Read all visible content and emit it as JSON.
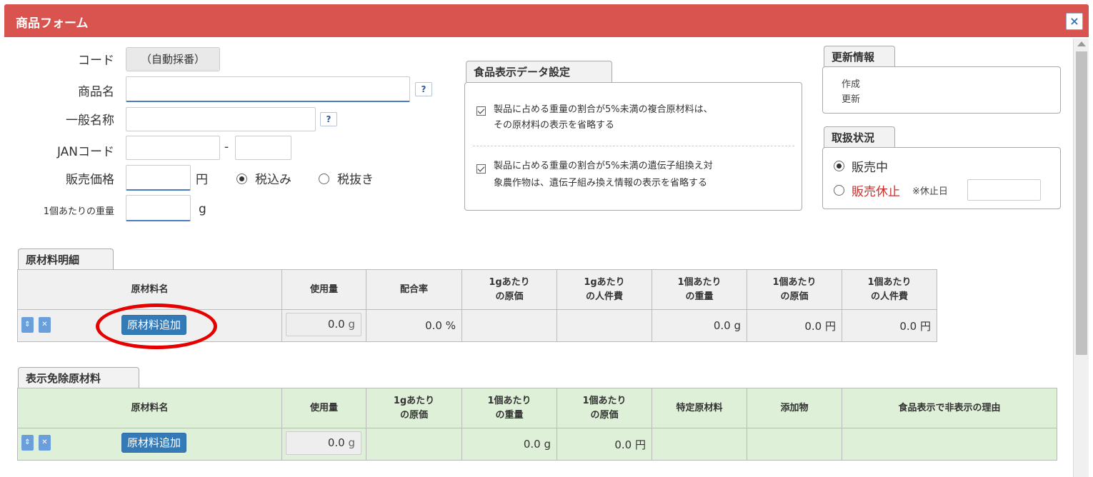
{
  "dialog": {
    "title": "商品フォーム",
    "close": "×"
  },
  "form": {
    "code_label": "コード",
    "code_value": "（自動採番）",
    "name_label": "商品名",
    "general_name_label": "一般名称",
    "help": "?",
    "jan_label": "JANコード",
    "jan_sep": "-",
    "price_label": "販売価格",
    "price_unit": "円",
    "tax_incl": "税込み",
    "tax_excl": "税抜き",
    "weight_label": "1個あたりの重量",
    "weight_unit": "g"
  },
  "food_display": {
    "legend": "食品表示データ設定",
    "option1_line1": "製品に占める重量の割合が5%未満の複合原材料は、",
    "option1_line2": "その原材料の表示を省略する",
    "option2_line1": "製品に占める重量の割合が5%未満の遺伝子組換え対",
    "option2_line2": "象農作物は、遺伝子組み換え情報の表示を省略する"
  },
  "update_info": {
    "legend": "更新情報",
    "created": "作成",
    "updated": "更新"
  },
  "handling": {
    "legend": "取扱状況",
    "on_sale": "販売中",
    "suspended": "販売休止",
    "suspend_date_label": "※休止日"
  },
  "materials": {
    "legend": "原材料明細",
    "headers": [
      [
        "原材料名"
      ],
      [
        "使用量"
      ],
      [
        "配合率"
      ],
      [
        "1gあたり",
        "の原価"
      ],
      [
        "1gあたり",
        "の人件費"
      ],
      [
        "1個あたり",
        "の重量"
      ],
      [
        "1個あたり",
        "の原価"
      ],
      [
        "1個あたり",
        "の人件費"
      ]
    ],
    "add_button": "原材料追加",
    "qty_value": "0.0",
    "qty_unit": "g",
    "ratio": "0.0 %",
    "weight_per_piece": "0.0 g",
    "cost_per_piece": "0.0 円",
    "labor_per_piece": "0.0 円"
  },
  "exempt": {
    "legend": "表示免除原材料",
    "headers": [
      [
        "原材料名"
      ],
      [
        "使用量"
      ],
      [
        "1gあたり",
        "の原価"
      ],
      [
        "1個あたり",
        "の重量"
      ],
      [
        "1個あたり",
        "の原価"
      ],
      [
        "特定原材料"
      ],
      [
        "添加物"
      ],
      [
        "食品表示で非表示の理由"
      ]
    ],
    "add_button": "原材料追加",
    "qty_value": "0.0",
    "qty_unit": "g",
    "weight_per_piece": "0.0 g",
    "cost_per_piece": "0.0 円"
  },
  "icons": {
    "sort": "sort-icon",
    "delete": "delete-icon",
    "radio": "radio-icon",
    "checkbox": "checkbox-icon"
  },
  "colors": {
    "title_bar": "#d9534f",
    "primary_button": "#337ab7",
    "exempt_table": "#dff0d8",
    "annotation": "#e60000",
    "suspended_text": "#c9302c"
  }
}
